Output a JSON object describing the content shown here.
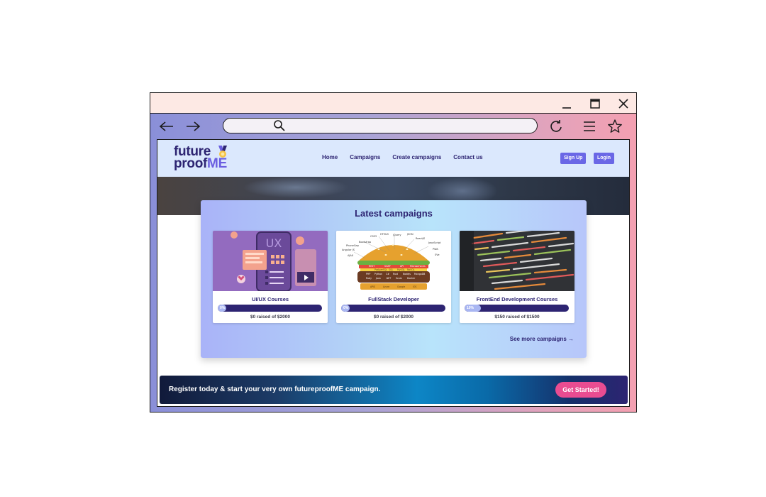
{
  "window": {
    "controls": [
      "minimize-icon",
      "maximize-icon",
      "close-icon"
    ]
  },
  "toolbar": {
    "icons": [
      "back-arrow-icon",
      "forward-arrow-icon",
      "search-icon",
      "reload-icon",
      "menu-icon",
      "star-icon"
    ],
    "url_value": ""
  },
  "site": {
    "logo_line1": "future",
    "logo_line2_a": "proof",
    "logo_line2_b": "ME",
    "nav": [
      "Home",
      "Campaigns",
      "Create campaigns",
      "Contact us"
    ],
    "signup": "Sign Up",
    "login": "Login"
  },
  "campaigns": {
    "title": "Latest campaigns",
    "cards": [
      {
        "title": "UI/UX Courses",
        "percent_label": "0%",
        "progress": 0.0,
        "raised": "$0 raised of $2000",
        "image": "ui-ux-illustration"
      },
      {
        "title": "FullStack Developer",
        "percent_label": "0%",
        "progress": 0.0,
        "raised": "$0 raised of $2000",
        "image": "fullstack-burger-illustration"
      },
      {
        "title": "FrontEnd Development Courses",
        "percent_label": "10%",
        "progress": 0.1,
        "raised": "$150 raised of $1500",
        "image": "code-screen-photo"
      }
    ],
    "see_more": "See more campaigns →"
  },
  "banner": {
    "text": "Register today & start your very own futureproofME campaign.",
    "button": "Get Started!"
  },
  "colors": {
    "brand_dark": "#2d2472",
    "brand_accent": "#6a67e6",
    "cta_pink": "#e94c91"
  }
}
